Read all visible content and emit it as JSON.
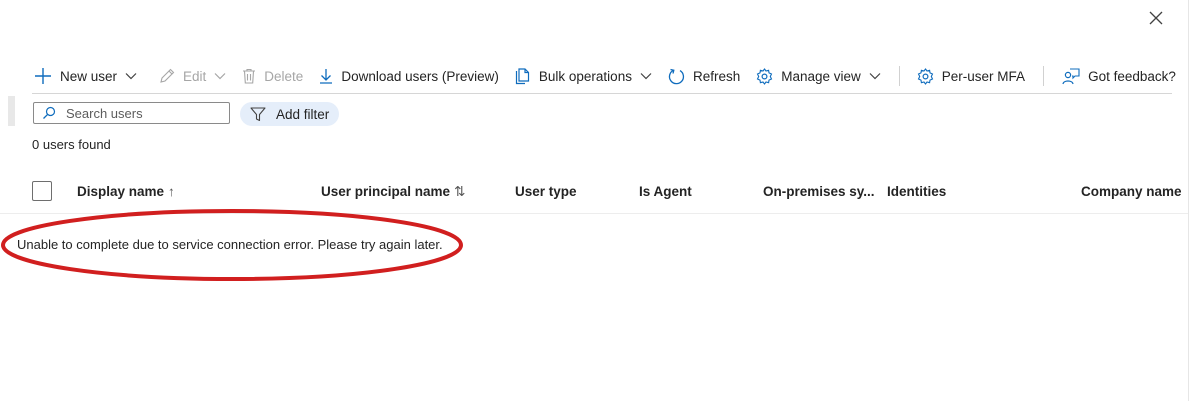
{
  "toolbar": {
    "new_user": "New user",
    "edit": "Edit",
    "delete": "Delete",
    "download_users": "Download users (Preview)",
    "bulk_operations": "Bulk operations",
    "refresh": "Refresh",
    "manage_view": "Manage view",
    "per_user_mfa": "Per-user MFA",
    "got_feedback": "Got feedback?"
  },
  "search": {
    "placeholder": "Search users",
    "value": ""
  },
  "filter": {
    "label": "Add filter"
  },
  "results": {
    "count_text": "0 users found"
  },
  "table": {
    "columns": [
      {
        "label": "Display name",
        "sort": "↑"
      },
      {
        "label": "User principal name",
        "sort": "⇅"
      },
      {
        "label": "User type"
      },
      {
        "label": "Is Agent"
      },
      {
        "label": "On-premises sy..."
      },
      {
        "label": "Identities"
      },
      {
        "label": "Company name"
      }
    ],
    "rows": []
  },
  "error": {
    "message": "Unable to complete due to service connection error. Please try again later."
  },
  "icons": {
    "close": "close-icon",
    "new_user": "plus-icon",
    "edit": "pencil-icon",
    "delete": "trash-icon",
    "download": "download-icon",
    "bulk": "document-copy-icon",
    "refresh": "refresh-icon",
    "manage_view": "gear-icon",
    "per_user_mfa": "gear-icon",
    "feedback": "feedback-person-icon",
    "search": "search-icon",
    "filter": "filter-icon"
  },
  "colors": {
    "accent": "#0f6cbd",
    "annotation": "#d11f1f",
    "filter_bg": "#e5eefa"
  }
}
